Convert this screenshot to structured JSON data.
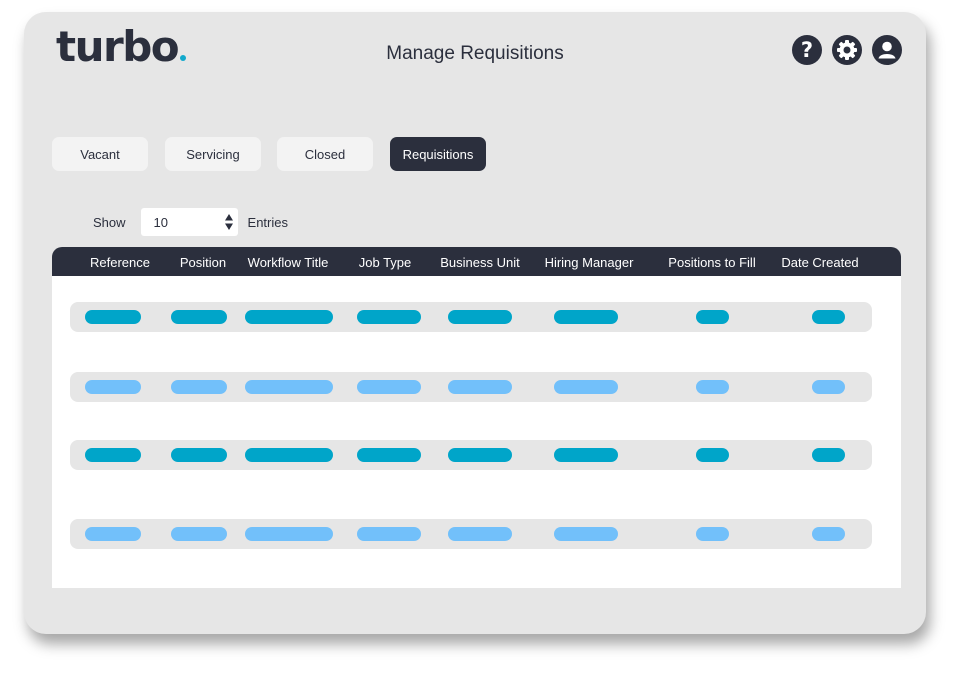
{
  "header": {
    "logo_text": "turbo",
    "page_title": "Manage Requisitions",
    "icons": [
      "help-icon",
      "settings-gear-icon",
      "user-profile-icon"
    ]
  },
  "tabs": [
    {
      "label": "Vacant",
      "active": false
    },
    {
      "label": "Servicing",
      "active": false
    },
    {
      "label": "Closed",
      "active": false
    },
    {
      "label": "Requisitions",
      "active": true
    }
  ],
  "entries": {
    "show_label": "Show",
    "value": "10",
    "entries_label": "Entries"
  },
  "table": {
    "columns": [
      "Reference",
      "Position",
      "Workflow Title",
      "Job Type",
      "Business Unit",
      "Hiring Manager",
      "Positions to Fill",
      "Date Created"
    ],
    "rows": [
      {
        "style": "dark"
      },
      {
        "style": "light"
      },
      {
        "style": "dark"
      },
      {
        "style": "light"
      }
    ]
  },
  "colors": {
    "brand_dark": "#2b2f3d",
    "accent_teal": "#00a5c9",
    "accent_light_blue": "#72c0fa",
    "background": "#e6e6e6"
  }
}
